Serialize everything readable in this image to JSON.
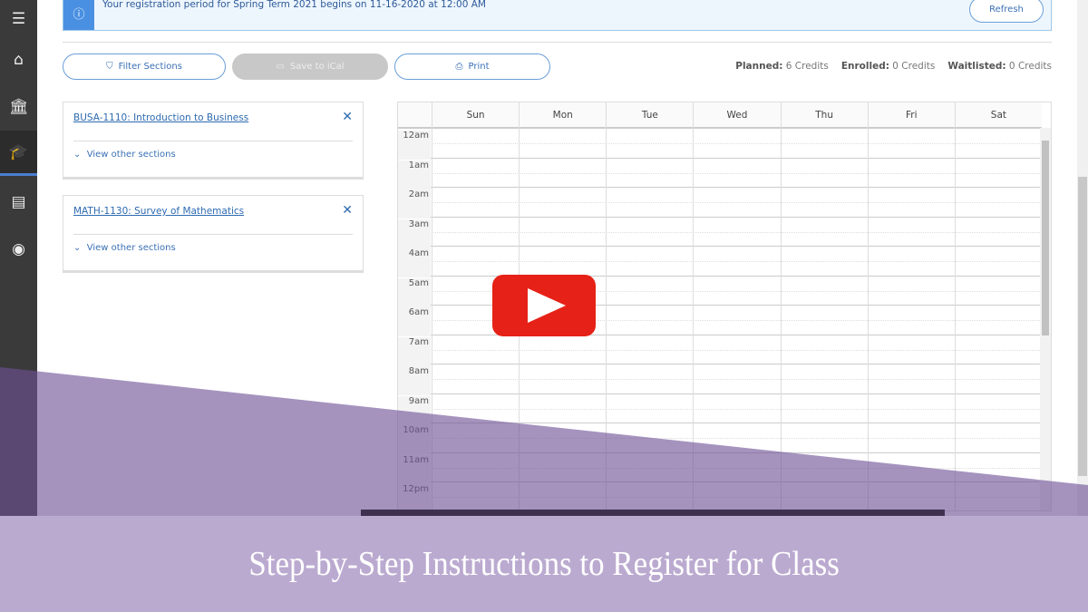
{
  "sidebar": {
    "items": [
      {
        "icon": "menu-icon",
        "glyph": "☰"
      },
      {
        "icon": "home-icon",
        "glyph": "⌂"
      },
      {
        "icon": "bank-icon",
        "glyph": "🏛"
      },
      {
        "icon": "graduation-cap-icon",
        "glyph": "🎓",
        "active": true
      },
      {
        "icon": "book-icon",
        "glyph": "▤"
      },
      {
        "icon": "user-circle-icon",
        "glyph": "◉"
      }
    ]
  },
  "banner": {
    "icon": "info-icon",
    "message": "Your registration period for Spring Term 2021 begins on 11-16-2020 at 12:00 AM",
    "refresh_label": "Refresh"
  },
  "toolbar": {
    "filter_label": "Filter Sections",
    "ical_label": "Save to iCal",
    "print_label": "Print"
  },
  "credits": {
    "planned_label": "Planned:",
    "planned_value": "6 Credits",
    "enrolled_label": "Enrolled:",
    "enrolled_value": "0 Credits",
    "waitlisted_label": "Waitlisted:",
    "waitlisted_value": "0 Credits"
  },
  "courses": [
    {
      "title": "BUSA-1110: Introduction to Business",
      "view_label": "View other sections"
    },
    {
      "title": "MATH-1130: Survey of Mathematics",
      "view_label": "View other sections"
    }
  ],
  "calendar": {
    "days": [
      "Sun",
      "Mon",
      "Tue",
      "Wed",
      "Thu",
      "Fri",
      "Sat"
    ],
    "hours": [
      "12am",
      "1am",
      "2am",
      "3am",
      "4am",
      "5am",
      "6am",
      "7am",
      "8am",
      "9am",
      "10am",
      "11am",
      "12pm"
    ]
  },
  "video": {
    "title": "Step-by-Step Instructions to Register for Class",
    "play_color": "#e62117",
    "overlay_color": "#bbaad0"
  }
}
